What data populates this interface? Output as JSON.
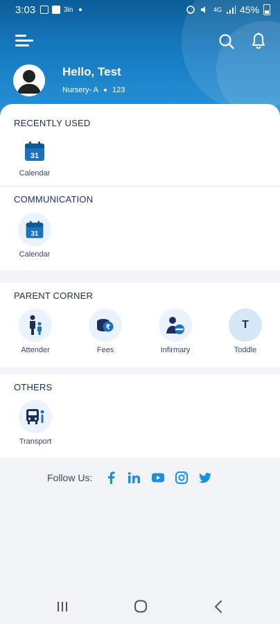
{
  "status_bar": {
    "time": "3:03",
    "small_text": "3in",
    "battery": "45%",
    "signal": "4G"
  },
  "header": {
    "greeting": "Hello, Test",
    "class_name": "Nursery- A",
    "roll_no": "123"
  },
  "sections": {
    "recent": {
      "title": "RECENTLY USED",
      "items": [
        {
          "label": "Calendar",
          "icon": "calendar-icon"
        }
      ]
    },
    "communication": {
      "title": "COMMUNICATION",
      "items": [
        {
          "label": "Calendar",
          "icon": "calendar-icon"
        }
      ]
    },
    "parent_corner": {
      "title": "PARENT CORNER",
      "items": [
        {
          "label": "Attender",
          "icon": "parent-child-icon"
        },
        {
          "label": "Fees",
          "icon": "coins-icon"
        },
        {
          "label": "Infirmary",
          "icon": "medical-icon"
        },
        {
          "label": "Toddle",
          "letter": "T"
        }
      ]
    },
    "others": {
      "title": "OTHERS",
      "items": [
        {
          "label": "Transport",
          "icon": "bus-icon"
        }
      ]
    }
  },
  "footer": {
    "follow_label": "Follow Us:"
  },
  "calendar_day": "31",
  "colors": {
    "primary": "#1b74bb",
    "social": "#1a8fe3",
    "dark_navy": "#1b2f5a"
  }
}
